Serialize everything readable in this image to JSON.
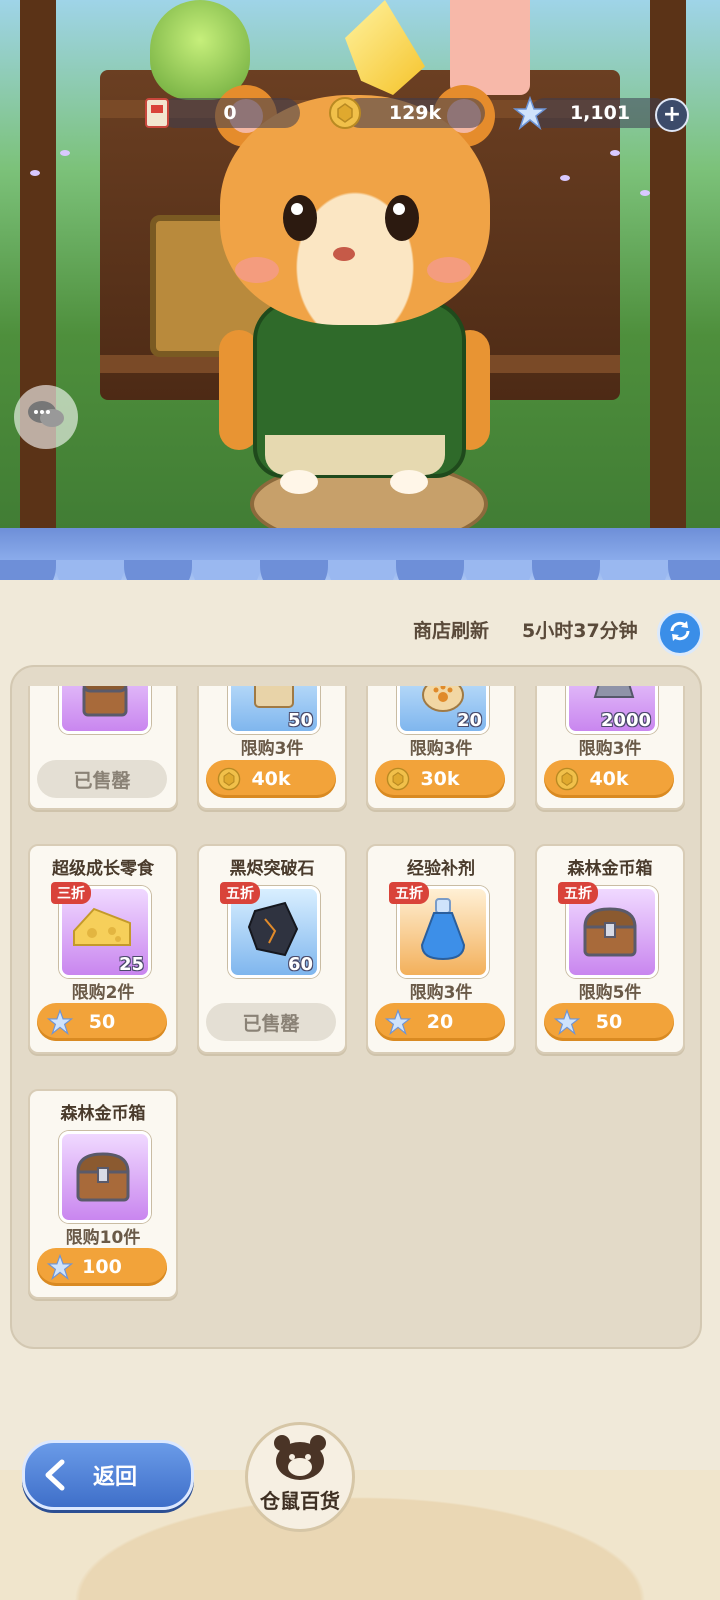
{
  "currency": {
    "tickets": "0",
    "coins": "129k",
    "stars": "1,101"
  },
  "shop": {
    "refresh_label": "商店刷新",
    "refresh_time": "5小时37分钟"
  },
  "items": [
    {
      "name": "",
      "limit": "",
      "price": "",
      "qty": "",
      "sold_out": true,
      "sold_label": "已售罄",
      "currency": "",
      "discount": ""
    },
    {
      "name": "",
      "limit": "限购3件",
      "price": "40k",
      "qty": "50",
      "sold_out": false,
      "currency": "coin",
      "discount": ""
    },
    {
      "name": "",
      "limit": "限购3件",
      "price": "30k",
      "qty": "20",
      "sold_out": false,
      "currency": "coin",
      "discount": ""
    },
    {
      "name": "",
      "limit": "限购3件",
      "price": "40k",
      "qty": "2000",
      "sold_out": false,
      "currency": "coin",
      "discount": ""
    },
    {
      "name": "超级成长零食",
      "limit": "限购2件",
      "price": "50",
      "qty": "25",
      "sold_out": false,
      "currency": "star",
      "discount": "三折"
    },
    {
      "name": "黑烬突破石",
      "limit": "",
      "price": "",
      "qty": "60",
      "sold_out": true,
      "sold_label": "已售罄",
      "currency": "",
      "discount": "五折"
    },
    {
      "name": "经验补剂",
      "limit": "限购3件",
      "price": "20",
      "qty": "",
      "sold_out": false,
      "currency": "star",
      "discount": "五折"
    },
    {
      "name": "森林金币箱",
      "limit": "限购5件",
      "price": "50",
      "qty": "",
      "sold_out": false,
      "currency": "star",
      "discount": "五折"
    },
    {
      "name": "森林金币箱",
      "limit": "限购10件",
      "price": "100",
      "qty": "",
      "sold_out": false,
      "currency": "star",
      "discount": ""
    }
  ],
  "footer": {
    "back_label": "返回",
    "shop_name": "仓鼠百货"
  },
  "colors": {
    "price_button": "#f2a33a",
    "discount_tag": "#d9433a",
    "awning": "#7b9de0",
    "back_button": "#4f7fd6"
  }
}
